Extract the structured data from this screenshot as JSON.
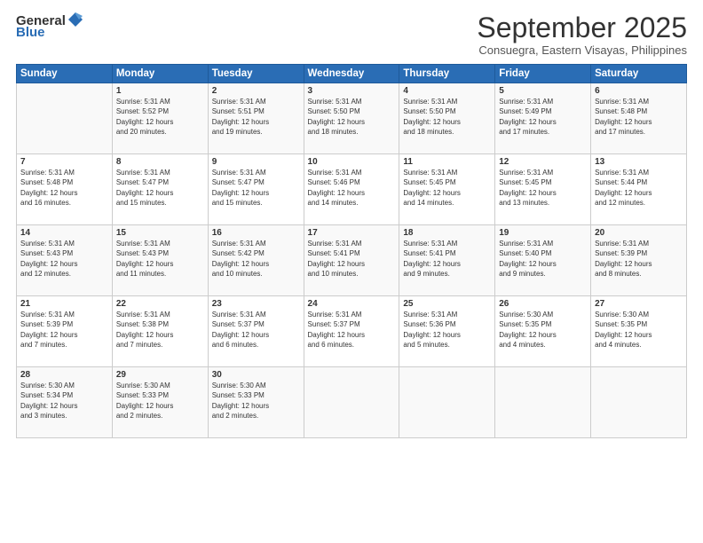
{
  "header": {
    "logo_general": "General",
    "logo_blue": "Blue",
    "month_title": "September 2025",
    "subtitle": "Consuegra, Eastern Visayas, Philippines"
  },
  "days_of_week": [
    "Sunday",
    "Monday",
    "Tuesday",
    "Wednesday",
    "Thursday",
    "Friday",
    "Saturday"
  ],
  "weeks": [
    [
      {
        "day": "",
        "info": ""
      },
      {
        "day": "1",
        "info": "Sunrise: 5:31 AM\nSunset: 5:52 PM\nDaylight: 12 hours\nand 20 minutes."
      },
      {
        "day": "2",
        "info": "Sunrise: 5:31 AM\nSunset: 5:51 PM\nDaylight: 12 hours\nand 19 minutes."
      },
      {
        "day": "3",
        "info": "Sunrise: 5:31 AM\nSunset: 5:50 PM\nDaylight: 12 hours\nand 18 minutes."
      },
      {
        "day": "4",
        "info": "Sunrise: 5:31 AM\nSunset: 5:50 PM\nDaylight: 12 hours\nand 18 minutes."
      },
      {
        "day": "5",
        "info": "Sunrise: 5:31 AM\nSunset: 5:49 PM\nDaylight: 12 hours\nand 17 minutes."
      },
      {
        "day": "6",
        "info": "Sunrise: 5:31 AM\nSunset: 5:48 PM\nDaylight: 12 hours\nand 17 minutes."
      }
    ],
    [
      {
        "day": "7",
        "info": "Sunrise: 5:31 AM\nSunset: 5:48 PM\nDaylight: 12 hours\nand 16 minutes."
      },
      {
        "day": "8",
        "info": "Sunrise: 5:31 AM\nSunset: 5:47 PM\nDaylight: 12 hours\nand 15 minutes."
      },
      {
        "day": "9",
        "info": "Sunrise: 5:31 AM\nSunset: 5:47 PM\nDaylight: 12 hours\nand 15 minutes."
      },
      {
        "day": "10",
        "info": "Sunrise: 5:31 AM\nSunset: 5:46 PM\nDaylight: 12 hours\nand 14 minutes."
      },
      {
        "day": "11",
        "info": "Sunrise: 5:31 AM\nSunset: 5:45 PM\nDaylight: 12 hours\nand 14 minutes."
      },
      {
        "day": "12",
        "info": "Sunrise: 5:31 AM\nSunset: 5:45 PM\nDaylight: 12 hours\nand 13 minutes."
      },
      {
        "day": "13",
        "info": "Sunrise: 5:31 AM\nSunset: 5:44 PM\nDaylight: 12 hours\nand 12 minutes."
      }
    ],
    [
      {
        "day": "14",
        "info": "Sunrise: 5:31 AM\nSunset: 5:43 PM\nDaylight: 12 hours\nand 12 minutes."
      },
      {
        "day": "15",
        "info": "Sunrise: 5:31 AM\nSunset: 5:43 PM\nDaylight: 12 hours\nand 11 minutes."
      },
      {
        "day": "16",
        "info": "Sunrise: 5:31 AM\nSunset: 5:42 PM\nDaylight: 12 hours\nand 10 minutes."
      },
      {
        "day": "17",
        "info": "Sunrise: 5:31 AM\nSunset: 5:41 PM\nDaylight: 12 hours\nand 10 minutes."
      },
      {
        "day": "18",
        "info": "Sunrise: 5:31 AM\nSunset: 5:41 PM\nDaylight: 12 hours\nand 9 minutes."
      },
      {
        "day": "19",
        "info": "Sunrise: 5:31 AM\nSunset: 5:40 PM\nDaylight: 12 hours\nand 9 minutes."
      },
      {
        "day": "20",
        "info": "Sunrise: 5:31 AM\nSunset: 5:39 PM\nDaylight: 12 hours\nand 8 minutes."
      }
    ],
    [
      {
        "day": "21",
        "info": "Sunrise: 5:31 AM\nSunset: 5:39 PM\nDaylight: 12 hours\nand 7 minutes."
      },
      {
        "day": "22",
        "info": "Sunrise: 5:31 AM\nSunset: 5:38 PM\nDaylight: 12 hours\nand 7 minutes."
      },
      {
        "day": "23",
        "info": "Sunrise: 5:31 AM\nSunset: 5:37 PM\nDaylight: 12 hours\nand 6 minutes."
      },
      {
        "day": "24",
        "info": "Sunrise: 5:31 AM\nSunset: 5:37 PM\nDaylight: 12 hours\nand 6 minutes."
      },
      {
        "day": "25",
        "info": "Sunrise: 5:31 AM\nSunset: 5:36 PM\nDaylight: 12 hours\nand 5 minutes."
      },
      {
        "day": "26",
        "info": "Sunrise: 5:30 AM\nSunset: 5:35 PM\nDaylight: 12 hours\nand 4 minutes."
      },
      {
        "day": "27",
        "info": "Sunrise: 5:30 AM\nSunset: 5:35 PM\nDaylight: 12 hours\nand 4 minutes."
      }
    ],
    [
      {
        "day": "28",
        "info": "Sunrise: 5:30 AM\nSunset: 5:34 PM\nDaylight: 12 hours\nand 3 minutes."
      },
      {
        "day": "29",
        "info": "Sunrise: 5:30 AM\nSunset: 5:33 PM\nDaylight: 12 hours\nand 2 minutes."
      },
      {
        "day": "30",
        "info": "Sunrise: 5:30 AM\nSunset: 5:33 PM\nDaylight: 12 hours\nand 2 minutes."
      },
      {
        "day": "",
        "info": ""
      },
      {
        "day": "",
        "info": ""
      },
      {
        "day": "",
        "info": ""
      },
      {
        "day": "",
        "info": ""
      }
    ]
  ]
}
